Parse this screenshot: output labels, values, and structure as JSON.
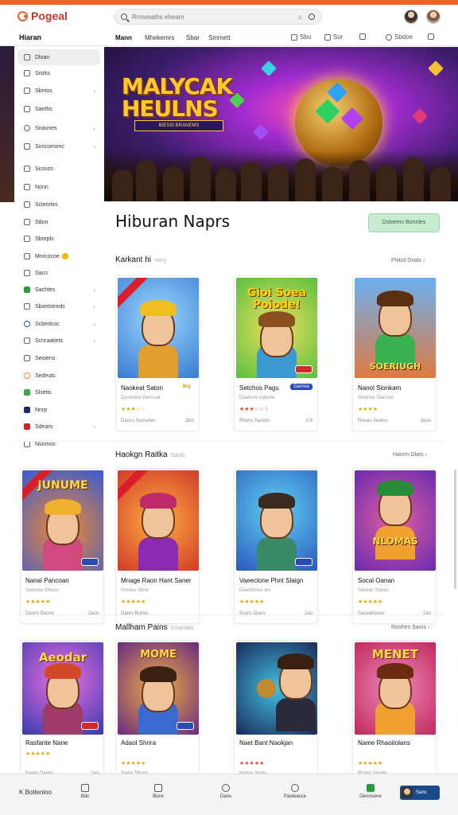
{
  "app": {
    "logo": "Pogeal"
  },
  "search": {
    "placeholder": "Rmsreaths eheam",
    "mic": "♫"
  },
  "subnav": {
    "brand": "Hiaran",
    "items": [
      "Mann",
      "Mhekemrs",
      "Sbar",
      "Smmett"
    ],
    "tools": [
      "Sbo",
      "Sor",
      "",
      "Sbdoe",
      ""
    ]
  },
  "sidebar": {
    "items": [
      {
        "label": "Dloan"
      },
      {
        "label": "Sisrks"
      },
      {
        "label": "Sbntos"
      },
      {
        "label": "Saeths"
      },
      {
        "label": "Snaones"
      },
      {
        "label": "Soncomonc"
      },
      {
        "label": "Scosos"
      },
      {
        "label": "Nonn"
      },
      {
        "label": "Sclenrles"
      },
      {
        "label": "Sdon"
      },
      {
        "label": "Sbrepls"
      },
      {
        "label": "Mnrcocoe"
      },
      {
        "label": "Sacn"
      },
      {
        "label": "Sachtes"
      },
      {
        "label": "Sbantotreds"
      },
      {
        "label": "Scbedcoc"
      },
      {
        "label": "Scnraatiets"
      },
      {
        "label": "Seoiens"
      },
      {
        "label": "Sedeuts"
      },
      {
        "label": "Slsetis"
      },
      {
        "label": "Nnrp"
      },
      {
        "label": "Sdears"
      },
      {
        "label": "Nsnmos"
      }
    ]
  },
  "hero": {
    "title_line1": "MALYCAK",
    "title_line2": "HEULNS",
    "subtitle": "BIESIS BRANEMS"
  },
  "page": {
    "heading": "Hiburan Naprs",
    "cta": "Dsloemn Bonnles"
  },
  "rows": [
    {
      "title": "Karkant hi",
      "faint": "nony",
      "link": "Fhitisl Dsals",
      "cards": [
        {
          "name": "Naokeat Saton",
          "tag": "Bry",
          "sub": "Dsnomne biecnsat",
          "rating": "★★★☆☆",
          "rv": "",
          "meta": "Dancs Soosehis",
          "size": "2bm",
          "art": ""
        },
        {
          "name": "Setchos Pagu",
          "tag": "Ganrea",
          "sub": "Dealsnts loanste",
          "rating": "★★★☆☆",
          "rv": "3",
          "meta": "Rhorls Sanrbs",
          "size": "2:6",
          "art": "Gioi Soea Poiode!"
        },
        {
          "name": "Nanol Sionkam",
          "tag": "",
          "sub": "Sionnos Siacrest",
          "rating": "★★★★",
          "rv": "",
          "meta": "Ronas Seams",
          "size": "3ooo",
          "art": "SOERIUGH"
        }
      ]
    },
    {
      "title": "Haokgn Raitka",
      "faint": "Sanib",
      "link": "Hainrn Dlats",
      "cards": [
        {
          "name": "Nanal Pancoan",
          "sub": "Sancote Sheiss",
          "rating": "★★★★★",
          "meta": "Donns Baons",
          "size": "2aoo",
          "art": "JUNUME"
        },
        {
          "name": "Mnage Raon Hant Saner",
          "sub": "Hrones Skrol",
          "rating": "★★★★★",
          "meta": "Danrs Bunks",
          "size": "",
          "art": ""
        },
        {
          "name": "Vaeeclone Phnt Slaign",
          "sub": "Deantonee sks",
          "rating": "★★★★★",
          "meta": "Scars Spars",
          "size": "2ao",
          "art": ""
        },
        {
          "name": "Socal Oanan",
          "sub": "Saovas Sanes",
          "rating": "★★★★★",
          "meta": "Saceatosres",
          "size": "2ao",
          "art": "NLOMAS"
        }
      ]
    },
    {
      "title": "Mallham Pains",
      "faint": "rcoamats",
      "link": "Ronhes Sams",
      "cards": [
        {
          "name": "Rasfante Nane",
          "sub": "★★★★★",
          "rating": "",
          "meta": "Daren Daens",
          "size": "2ao",
          "art": "Aeodar"
        },
        {
          "name": "Adaol Shrira",
          "sub": "",
          "rating": "★★★★★",
          "meta": "Siane Shons",
          "size": "",
          "art": "MOME"
        },
        {
          "name": "Naet Bant Naokjan",
          "sub": "",
          "rating": "★★★★★",
          "meta": "Iosnos Snnis",
          "size": "",
          "art": ""
        },
        {
          "name": "Name Rhaoitolans",
          "sub": "",
          "rating": "★★★★★",
          "meta": "Rnans Soone",
          "size": "",
          "art": "MENET"
        }
      ]
    }
  ],
  "bottombar": {
    "back": "Botlenloo",
    "items": [
      "Bdc",
      "Bons",
      "Daos",
      "Pasteasce",
      "Oeonsone"
    ],
    "profile": "Sanc"
  }
}
